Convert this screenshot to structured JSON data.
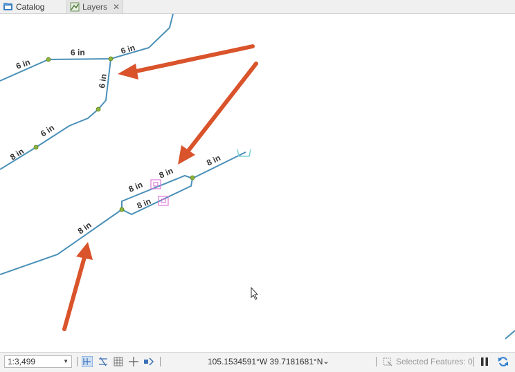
{
  "tabs": [
    {
      "label": "Catalog",
      "icon": "catalog-icon"
    },
    {
      "label": "Layers",
      "icon": "layers-icon",
      "close": "✕"
    }
  ],
  "map": {
    "pipe_color": "#4a90b8",
    "junction_color": "#8db33a",
    "arrow_color": "#d9532b",
    "labels": [
      "6 in",
      "6 in",
      "6 in",
      "6 in",
      "6 in",
      "8 in",
      "8 in",
      "8 in",
      "8 in",
      "8 in",
      "8 in"
    ]
  },
  "status": {
    "scale": "1:3,499",
    "coordinates": "105.1534591°W 39.7181681°N",
    "selected_features": "Selected Features: 0"
  }
}
